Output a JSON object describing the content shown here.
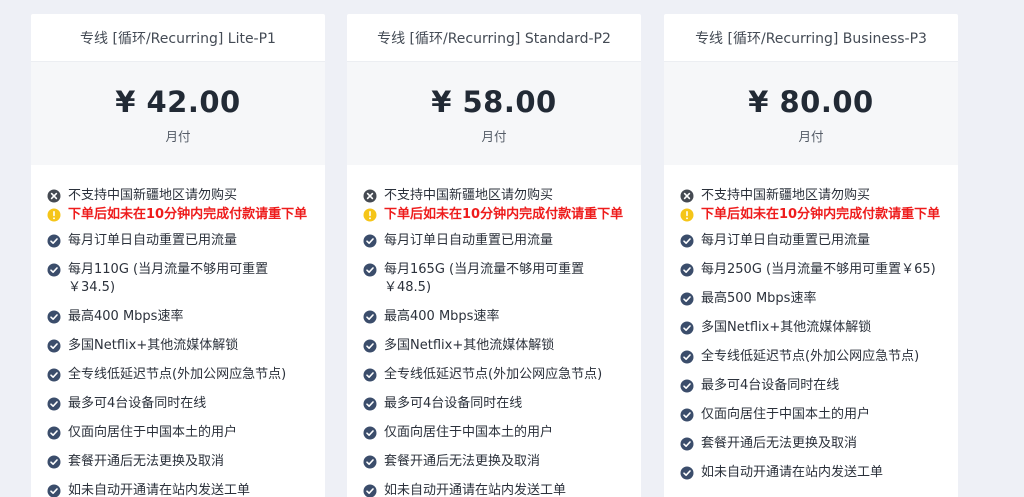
{
  "plans": [
    {
      "title": "专线 [循环/Recurring] Lite-P1",
      "price": "¥ 42.00",
      "period": "月付",
      "features": [
        {
          "type": "note",
          "icon": "x-circle-icon",
          "text": "不支持中国新疆地区请勿购买"
        },
        {
          "type": "warn",
          "icon": "warning-icon",
          "text": "下单后如未在10分钟内完成付款请重下单"
        },
        {
          "type": "check",
          "icon": "check-circle-icon",
          "text": "每月订单日自动重置已用流量"
        },
        {
          "type": "check",
          "icon": "check-circle-icon",
          "text": "每月110G (当月流量不够用可重置 ￥34.5)"
        },
        {
          "type": "check",
          "icon": "check-circle-icon",
          "text": "最高400 Mbps速率"
        },
        {
          "type": "check",
          "icon": "check-circle-icon",
          "text": "多国Netflix+其他流媒体解锁"
        },
        {
          "type": "check",
          "icon": "check-circle-icon",
          "text": "全专线低延迟节点(外加公网应急节点)"
        },
        {
          "type": "check",
          "icon": "check-circle-icon",
          "text": "最多可4台设备同时在线"
        },
        {
          "type": "check",
          "icon": "check-circle-icon",
          "text": "仅面向居住于中国本土的用户"
        },
        {
          "type": "check",
          "icon": "check-circle-icon",
          "text": "套餐开通后无法更换及取消"
        },
        {
          "type": "check",
          "icon": "check-circle-icon",
          "text": "如未自动开通请在站内发送工单"
        }
      ]
    },
    {
      "title": "专线 [循环/Recurring] Standard-P2",
      "price": "¥ 58.00",
      "period": "月付",
      "features": [
        {
          "type": "note",
          "icon": "x-circle-icon",
          "text": "不支持中国新疆地区请勿购买"
        },
        {
          "type": "warn",
          "icon": "warning-icon",
          "text": "下单后如未在10分钟内完成付款请重下单"
        },
        {
          "type": "check",
          "icon": "check-circle-icon",
          "text": "每月订单日自动重置已用流量"
        },
        {
          "type": "check",
          "icon": "check-circle-icon",
          "text": "每月165G (当月流量不够用可重置 ￥48.5)"
        },
        {
          "type": "check",
          "icon": "check-circle-icon",
          "text": "最高400 Mbps速率"
        },
        {
          "type": "check",
          "icon": "check-circle-icon",
          "text": "多国Netflix+其他流媒体解锁"
        },
        {
          "type": "check",
          "icon": "check-circle-icon",
          "text": "全专线低延迟节点(外加公网应急节点)"
        },
        {
          "type": "check",
          "icon": "check-circle-icon",
          "text": "最多可4台设备同时在线"
        },
        {
          "type": "check",
          "icon": "check-circle-icon",
          "text": "仅面向居住于中国本土的用户"
        },
        {
          "type": "check",
          "icon": "check-circle-icon",
          "text": "套餐开通后无法更换及取消"
        },
        {
          "type": "check",
          "icon": "check-circle-icon",
          "text": "如未自动开通请在站内发送工单"
        }
      ]
    },
    {
      "title": "专线 [循环/Recurring] Business-P3",
      "price": "¥ 80.00",
      "period": "月付",
      "features": [
        {
          "type": "note",
          "icon": "x-circle-icon",
          "text": "不支持中国新疆地区请勿购买"
        },
        {
          "type": "warn",
          "icon": "warning-icon",
          "text": "下单后如未在10分钟内完成付款请重下单"
        },
        {
          "type": "check",
          "icon": "check-circle-icon",
          "text": "每月订单日自动重置已用流量"
        },
        {
          "type": "check",
          "icon": "check-circle-icon",
          "text": "每月250G (当月流量不够用可重置￥65)"
        },
        {
          "type": "check",
          "icon": "check-circle-icon",
          "text": "最高500 Mbps速率"
        },
        {
          "type": "check",
          "icon": "check-circle-icon",
          "text": "多国Netflix+其他流媒体解锁"
        },
        {
          "type": "check",
          "icon": "check-circle-icon",
          "text": "全专线低延迟节点(外加公网应急节点)"
        },
        {
          "type": "check",
          "icon": "check-circle-icon",
          "text": "最多可4台设备同时在线"
        },
        {
          "type": "check",
          "icon": "check-circle-icon",
          "text": "仅面向居住于中国本土的用户"
        },
        {
          "type": "check",
          "icon": "check-circle-icon",
          "text": "套餐开通后无法更换及取消"
        },
        {
          "type": "check",
          "icon": "check-circle-icon",
          "text": "如未自动开通请在站内发送工单"
        }
      ]
    }
  ],
  "colors": {
    "background": "#eef0f6",
    "card": "#ffffff",
    "price_band": "#f6f7f9",
    "check_icon": "#3b4d6b",
    "note_icon": "#454a52",
    "warn_icon": "#f5c518",
    "warn_text": "#ee1c1c"
  }
}
